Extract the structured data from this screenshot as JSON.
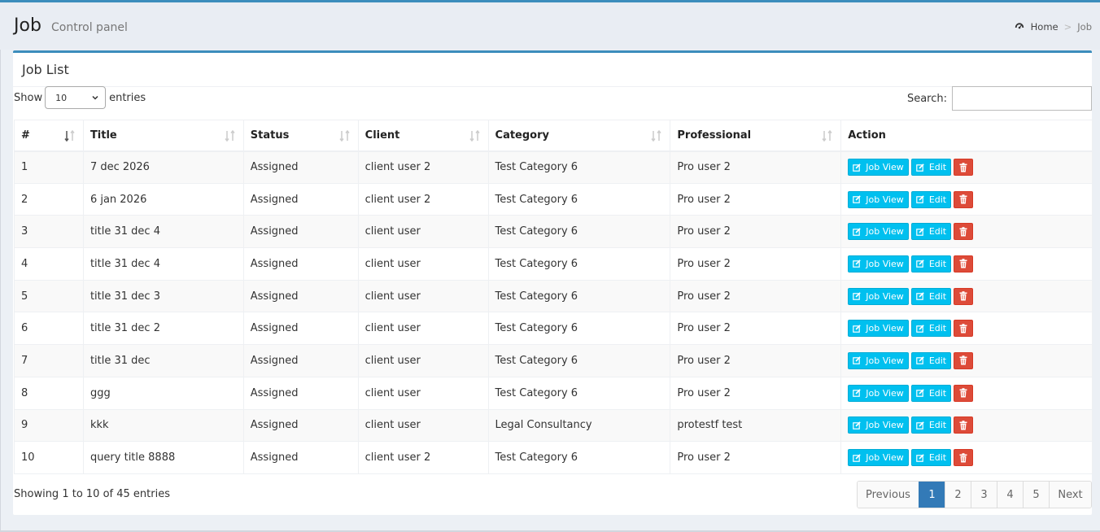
{
  "header": {
    "title": "Job",
    "subtitle": "Control panel"
  },
  "breadcrumb": {
    "home_label": "Home",
    "current": "Job",
    "separator": ">"
  },
  "box": {
    "title": "Job List"
  },
  "controls": {
    "show_label": "Show",
    "page_size": "10",
    "entries_label": "entries",
    "search_label": "Search:",
    "search_value": ""
  },
  "table": {
    "columns": [
      "#",
      "Title",
      "Status",
      "Client",
      "Category",
      "Professional",
      "Action"
    ],
    "rows": [
      [
        "1",
        "7 dec 2026",
        "Assigned",
        "client user 2",
        "Test Category 6",
        "Pro user 2"
      ],
      [
        "2",
        "6 jan 2026",
        "Assigned",
        "client user 2",
        "Test Category 6",
        "Pro user 2"
      ],
      [
        "3",
        "title 31 dec 4",
        "Assigned",
        "client user",
        "Test Category 6",
        "Pro user 2"
      ],
      [
        "4",
        "title 31 dec 4",
        "Assigned",
        "client user",
        "Test Category 6",
        "Pro user 2"
      ],
      [
        "5",
        "title 31 dec 3",
        "Assigned",
        "client user",
        "Test Category 6",
        "Pro user 2"
      ],
      [
        "6",
        "title 31 dec 2",
        "Assigned",
        "client user",
        "Test Category 6",
        "Pro user 2"
      ],
      [
        "7",
        "title 31 dec",
        "Assigned",
        "client user",
        "Test Category 6",
        "Pro user 2"
      ],
      [
        "8",
        "ggg",
        "Assigned",
        "client user",
        "Test Category 6",
        "Pro user 2"
      ],
      [
        "9",
        "kkk",
        "Assigned",
        "client user",
        "Legal Consultancy",
        "protestf test"
      ],
      [
        "10",
        "query title 8888",
        "Assigned",
        "client user 2",
        "Test Category 6",
        "Pro user 2"
      ]
    ],
    "actions": {
      "view_label": "Job View",
      "edit_label": "Edit"
    }
  },
  "footer": {
    "info": "Showing 1 to 10 of 45 entries",
    "pagination": {
      "previous": "Previous",
      "pages": [
        "1",
        "2",
        "3",
        "4",
        "5"
      ],
      "active": "1",
      "next": "Next"
    }
  },
  "colors": {
    "accent": "#3c8dbc",
    "info_button": "#00c0ef",
    "danger_button": "#dd4b39",
    "active_page": "#337ab7"
  },
  "icons": {
    "breadcrumb": "dashboard-icon",
    "sort": "sort-icon",
    "view": "edit-square-icon",
    "edit": "edit-square-icon",
    "delete": "trash-icon"
  }
}
